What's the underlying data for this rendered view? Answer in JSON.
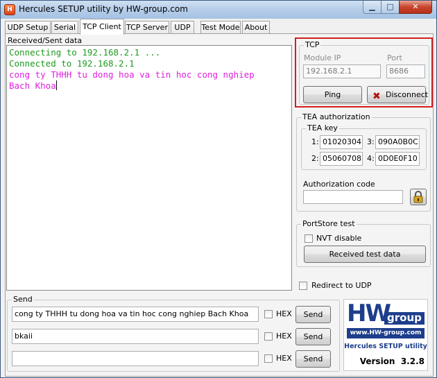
{
  "window": {
    "title": "Hercules SETUP utility by HW-group.com",
    "minimize_glyph": "▁",
    "maximize_glyph": "□",
    "close_glyph": "✕"
  },
  "tabs": [
    "UDP Setup",
    "Serial",
    "TCP Client",
    "TCP Server",
    "UDP",
    "Test Mode",
    "About"
  ],
  "active_tab": "TCP Client",
  "received": {
    "label": "Received/Sent data",
    "lines": [
      {
        "text": "Connecting to 192.168.2.1 ...",
        "color": "#1e9a1e"
      },
      {
        "text": "Connected to 192.168.2.1",
        "color": "#1e9a1e"
      },
      {
        "text": "cong ty THHH tu dong hoa va tin hoc cong nghiep",
        "color": "#e020e0"
      },
      {
        "text": "Bach Khoa",
        "color": "#e020e0"
      }
    ]
  },
  "tcp": {
    "title": "TCP",
    "module_ip_label": "Module IP",
    "module_ip": "192.168.2.1",
    "port_label": "Port",
    "port": "8686",
    "ping_label": "Ping",
    "disconnect_label": "Disconnect",
    "disconnect_icon": "x-icon"
  },
  "tea": {
    "title": "TEA authorization",
    "key_title": "TEA key",
    "keys": [
      {
        "n": "1:",
        "value": "01020304"
      },
      {
        "n": "2:",
        "value": "05060708"
      },
      {
        "n": "3:",
        "value": "090A0B0C"
      },
      {
        "n": "4:",
        "value": "0D0E0F10"
      }
    ],
    "auth_label": "Authorization code",
    "auth_value": "",
    "lock_icon": "lock-icon"
  },
  "portstore": {
    "title": "PortStore test",
    "nvt_label": "NVT disable",
    "nvt_checked": false,
    "received_button": "Received test data"
  },
  "redirect": {
    "label": "Redirect to UDP",
    "checked": false
  },
  "send": {
    "title": "Send",
    "rows": [
      {
        "value": "cong ty THHH tu dong hoa va tin hoc cong nghiep Bach Khoa",
        "hex_label": "HEX",
        "hex_checked": false,
        "button": "Send"
      },
      {
        "value": "bkaii",
        "hex_label": "HEX",
        "hex_checked": false,
        "button": "Send"
      },
      {
        "value": "",
        "hex_label": "HEX",
        "hex_checked": false,
        "button": "Send"
      }
    ]
  },
  "logo": {
    "brand_hw": "HW",
    "brand_group": "group",
    "url": "www.HW-group.com",
    "product": "Hercules SETUP utility",
    "version": "Version  3.2.8"
  },
  "colors": {
    "accent_red": "#d21e1e",
    "green": "#1e9a1e",
    "magenta": "#e020e0",
    "logo_blue": "#1d3e8c"
  }
}
